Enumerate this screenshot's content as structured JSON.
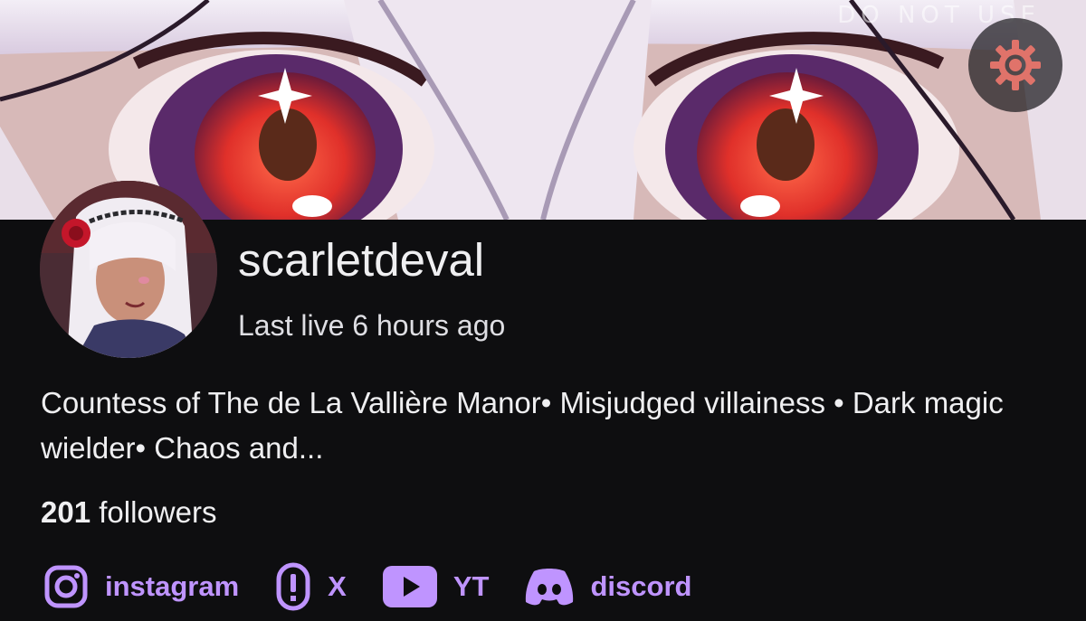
{
  "banner": {
    "watermark": "DO NOT USE",
    "settings_icon": "gear-icon"
  },
  "channel": {
    "name": "scarletdeval",
    "last_live": "Last live 6 hours ago",
    "bio": "Countess of The de La Vallière Manor• Misjudged villainess • Dark magic wielder• Chaos and...",
    "followers_count": "201",
    "followers_label": "followers"
  },
  "social_links": [
    {
      "icon": "instagram-icon",
      "label": "instagram"
    },
    {
      "icon": "x-icon",
      "label": "X"
    },
    {
      "icon": "youtube-icon",
      "label": "YT"
    },
    {
      "icon": "discord-icon",
      "label": "discord"
    }
  ],
  "colors": {
    "background": "#0e0e10",
    "text": "#efeff1",
    "link_accent": "#bf94ff",
    "settings_gear": "#e0736a"
  }
}
